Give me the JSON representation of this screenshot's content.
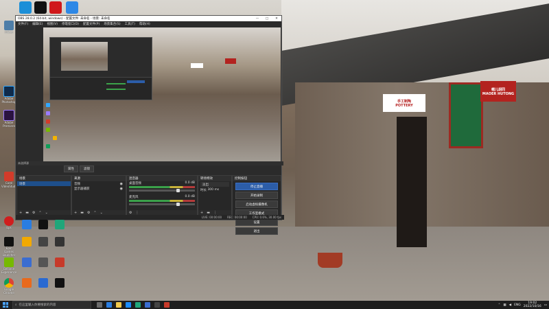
{
  "obs": {
    "title": "OBS 28.0.2 (64-bit, windows) - 配置文件: 未命名 - 场景: 未命名",
    "menu": [
      "文件(F)",
      "编辑(E)",
      "视图(V)",
      "停靠窗口(D)",
      "配置文件(P)",
      "场景集合(S)",
      "工具(T)",
      "帮助(H)"
    ],
    "status_label": "未选择源",
    "tab_properties": "属性",
    "tab_filters": "滤镜",
    "scenes": {
      "header": "场景",
      "items": [
        "场景"
      ]
    },
    "sources": {
      "header": "来源",
      "items": [
        "音频",
        "显示器捕获"
      ]
    },
    "mixer": {
      "header": "混音器",
      "channels": [
        {
          "name": "桌面音频",
          "db": "0.0 dB",
          "level": 0.72
        },
        {
          "name": "麦克风",
          "db": "0.0 dB",
          "level": 0.72
        }
      ]
    },
    "transitions": {
      "header": "转场特效",
      "type": "淡出",
      "duration_label": "时长",
      "duration": "300 ms"
    },
    "controls": {
      "header": "控制按钮",
      "buttons": [
        "停止直播",
        "开始录制",
        "启动虚拟摄像机",
        "工作室模式",
        "设置",
        "退出"
      ]
    },
    "statusbar": {
      "live": "LIVE: 00:00:00",
      "rec": "REC: 00:00:00",
      "cpu": "CPU: 0.6%, 30.00 fps"
    },
    "controls_window": [
      "—",
      "□",
      "✕"
    ]
  },
  "scene_signs": {
    "pottery_sign": "手工制陶\nPOTTERY",
    "hutong_sign": "帽儿胡同\nMAOER HUTONG"
  },
  "taskbar": {
    "search_placeholder": "在这里输入你要搜索的内容",
    "tray_lang": "ENG",
    "time": "19:02",
    "date": "2022/10/16"
  },
  "desktop_icons": [
    {
      "label": "回收站"
    },
    {
      "label": "Adobe Photoshop"
    },
    {
      "label": "Adobe Premiere"
    },
    {
      "label": "Corel VideoStudio"
    },
    {
      "label": "Eps"
    },
    {
      "label": "Epic Games Launcher"
    },
    {
      "label": "GeForce Experience"
    },
    {
      "label": "Google Chrome"
    }
  ],
  "colors": {
    "accent": "#2c5da8",
    "selected": "#1e4f8b",
    "meter": "#3aa14a"
  }
}
